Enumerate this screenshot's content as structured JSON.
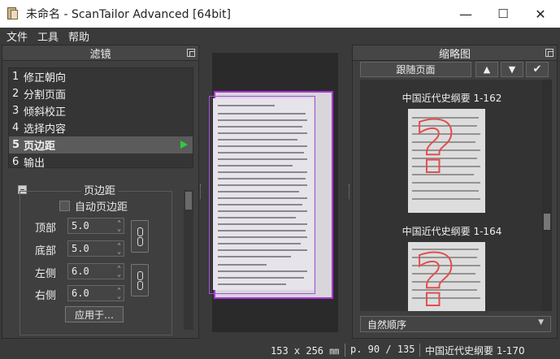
{
  "window": {
    "title": "未命名 - ScanTailor Advanced [64bit]",
    "minimize": "—",
    "maximize": "☐",
    "close": "✕"
  },
  "menu": [
    "文件",
    "工具",
    "帮助"
  ],
  "filters_panel": {
    "title": "滤镜",
    "stages": [
      {
        "num": "1",
        "label": "修正朝向"
      },
      {
        "num": "2",
        "label": "分割页面"
      },
      {
        "num": "3",
        "label": "倾斜校正"
      },
      {
        "num": "4",
        "label": "选择内容"
      },
      {
        "num": "5",
        "label": "页边距"
      },
      {
        "num": "6",
        "label": "输出"
      }
    ],
    "active_stage": 4
  },
  "margins": {
    "group_title": "页边距",
    "auto_margins_label": "自动页边距",
    "auto_margins_checked": false,
    "top_label": "顶部",
    "top_value": "5.0",
    "bottom_label": "底部",
    "bottom_value": "5.0",
    "left_label": "左侧",
    "left_value": "6.0",
    "right_label": "右侧",
    "right_value": "6.0",
    "apply_label": "应用于…"
  },
  "thumbnails_panel": {
    "title": "缩略图",
    "follow_label": "跟随页面",
    "up_label": "▲",
    "down_label": "▼",
    "confirm_label": "✔",
    "items": [
      {
        "label": "中国近代史纲要 1-162"
      },
      {
        "label": "中国近代史纲要 1-164"
      }
    ],
    "sort_label": "自然顺序"
  },
  "status": {
    "dimensions": "153 x 256 ㎜",
    "page": "p. 90 / 135",
    "file": "中国近代史纲要 1-170"
  },
  "colors": {
    "accent_selection": "#b030e0",
    "active_indicator": "#2ecc40"
  }
}
